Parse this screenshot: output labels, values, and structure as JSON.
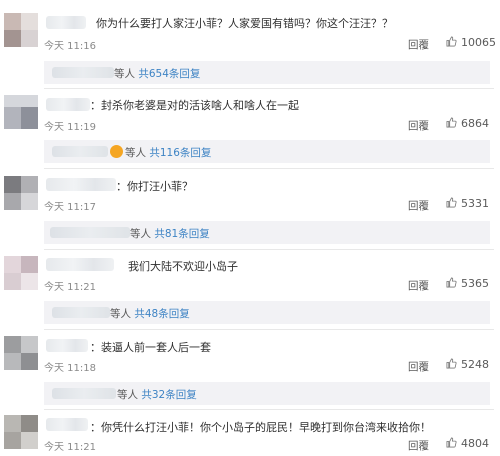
{
  "reply_label": "回覆",
  "comments": [
    {
      "text": "你为什么要打人家汪小菲？人家爱国有错吗？你这个汪汪？？",
      "time": "今天 11:16",
      "likes": "10065",
      "sub_suffix": "等人",
      "sub_count": "共654条回复",
      "has_emoji": false
    },
    {
      "text": "：封杀你老婆是对的活该啥人和啥人在一起",
      "time": "今天 11:19",
      "likes": "6864",
      "sub_suffix": "等人",
      "sub_count": "共116条回复",
      "has_emoji": true
    },
    {
      "text": "：你打汪小菲？",
      "time": "今天 11:17",
      "likes": "5331",
      "sub_suffix": "等人",
      "sub_count": "共81条回复",
      "has_emoji": false
    },
    {
      "text": "我们大陆不欢迎小岛子",
      "time": "今天 11:21",
      "likes": "5365",
      "sub_suffix": "等人",
      "sub_count": "共48条回复",
      "has_emoji": false
    },
    {
      "text": "：装逼人前一套人后一套",
      "time": "今天 11:18",
      "likes": "5248",
      "sub_suffix": "等人",
      "sub_count": "共32条回复",
      "has_emoji": false
    },
    {
      "text": "：你凭什么打汪小菲！你个小岛子的屁民！早晚打到你台湾来收拾你！",
      "time": "今天 11:21",
      "likes": "4804"
    }
  ],
  "colors": {
    "link": "#3d83c4",
    "sub_bg": "#f2f2f5",
    "text": "#2f2f2f",
    "meta": "#8a8a8a"
  }
}
